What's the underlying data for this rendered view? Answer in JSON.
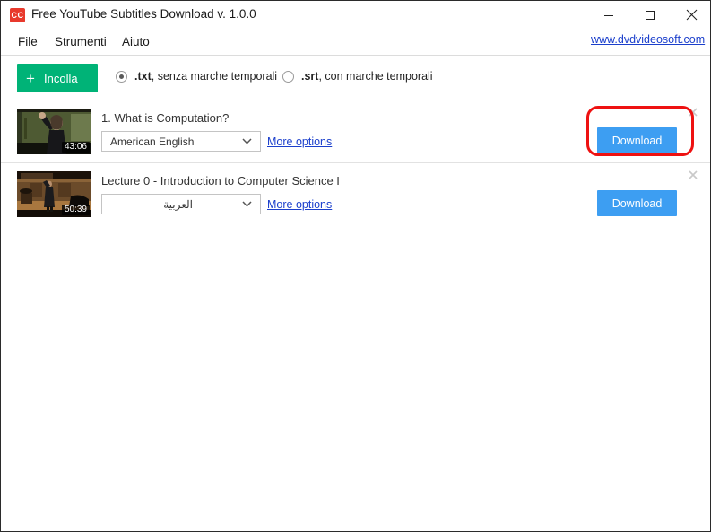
{
  "window": {
    "title": "Free YouTube Subtitles Download v. 1.0.0",
    "icon_text": "CC",
    "icon_name": "cc-app-icon",
    "controls": {
      "minimize": "minimize-icon",
      "maximize": "maximize-icon",
      "close": "close-icon"
    }
  },
  "menu": {
    "items": [
      {
        "label": "File"
      },
      {
        "label": "Strumenti"
      },
      {
        "label": "Aiuto"
      }
    ]
  },
  "weblink": {
    "label": "www.dvdvideosoft.com"
  },
  "toolbar": {
    "paste_button": {
      "label": "Incolla",
      "plus_icon": "plus-icon",
      "color": "#00b377"
    },
    "format_options": [
      {
        "id": "txt",
        "bold": ".txt",
        "rest": ", senza marche temporali",
        "selected": true
      },
      {
        "id": "srt",
        "bold": ".srt",
        "rest": ", con marche temporali",
        "selected": false
      }
    ]
  },
  "videos": [
    {
      "title": "1. What is Computation?",
      "duration": "43:06",
      "language": "American English",
      "language_rtl": false,
      "more_options_label": "More options",
      "download_label": "Download",
      "remove_icon": "close-icon",
      "highlighted": true
    },
    {
      "title": "Lecture 0 - Introduction to Computer Science I",
      "duration": "50:39",
      "language": "العربية",
      "language_rtl": true,
      "more_options_label": "More options",
      "download_label": "Download",
      "remove_icon": "close-icon",
      "highlighted": false
    }
  ],
  "colors": {
    "accent_green": "#00b377",
    "accent_blue": "#3d9ef2",
    "link_blue": "#1b3fcc",
    "annotation_red": "#ee1111",
    "app_icon_red": "#e8392c"
  }
}
